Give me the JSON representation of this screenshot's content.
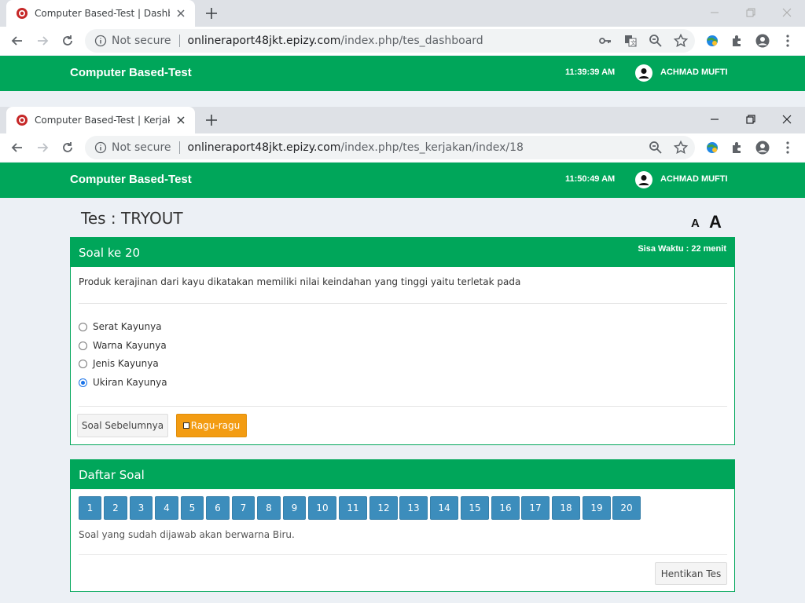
{
  "back_window": {
    "tab_title": "Computer Based-Test | Dashboard",
    "url_host": "onlineraport48jkt.epizy.com",
    "url_path": "/index.php/tes_dashboard",
    "security": "Not secure",
    "brand": "Computer Based-Test",
    "clock": "11:39:39 AM",
    "user": "ACHMAD MUFTI"
  },
  "front_window": {
    "tab_title": "Computer Based-Test | Kerjakan Tes",
    "url_host": "onlineraport48jkt.epizy.com",
    "url_path": "/index.php/tes_kerjakan/index/18",
    "security": "Not secure",
    "brand": "Computer Based-Test",
    "clock": "11:50:49 AM",
    "user": "ACHMAD MUFTI"
  },
  "page": {
    "test_title": "Tes : TRYOUT",
    "font_small_label": "A",
    "font_big_label": "A"
  },
  "question_box": {
    "header": "Soal ke 20",
    "timer": "Sisa Waktu : 22 menit",
    "question": "Produk kerajinan dari kayu dikatakan memiliki nilai keindahan yang tinggi yaitu terletak pada",
    "options": [
      {
        "label": "Serat Kayunya",
        "selected": false
      },
      {
        "label": "Warna Kayunya",
        "selected": false
      },
      {
        "label": "Jenis Kayunya",
        "selected": false
      },
      {
        "label": "Ukiran Kayunya",
        "selected": true
      }
    ],
    "prev_button": "Soal Sebelumnya",
    "doubt_button": "Ragu-ragu"
  },
  "list_box": {
    "header": "Daftar Soal",
    "numbers": [
      "1",
      "2",
      "3",
      "4",
      "5",
      "6",
      "7",
      "8",
      "9",
      "10",
      "11",
      "12",
      "13",
      "14",
      "15",
      "16",
      "17",
      "18",
      "19",
      "20"
    ],
    "note": "Soal yang sudah dijawab akan berwarna Biru.",
    "stop_button": "Hentikan Tes"
  },
  "colors": {
    "navbar": "#00a65a",
    "answered": "#3c8dbc",
    "doubt": "#f39c12"
  }
}
